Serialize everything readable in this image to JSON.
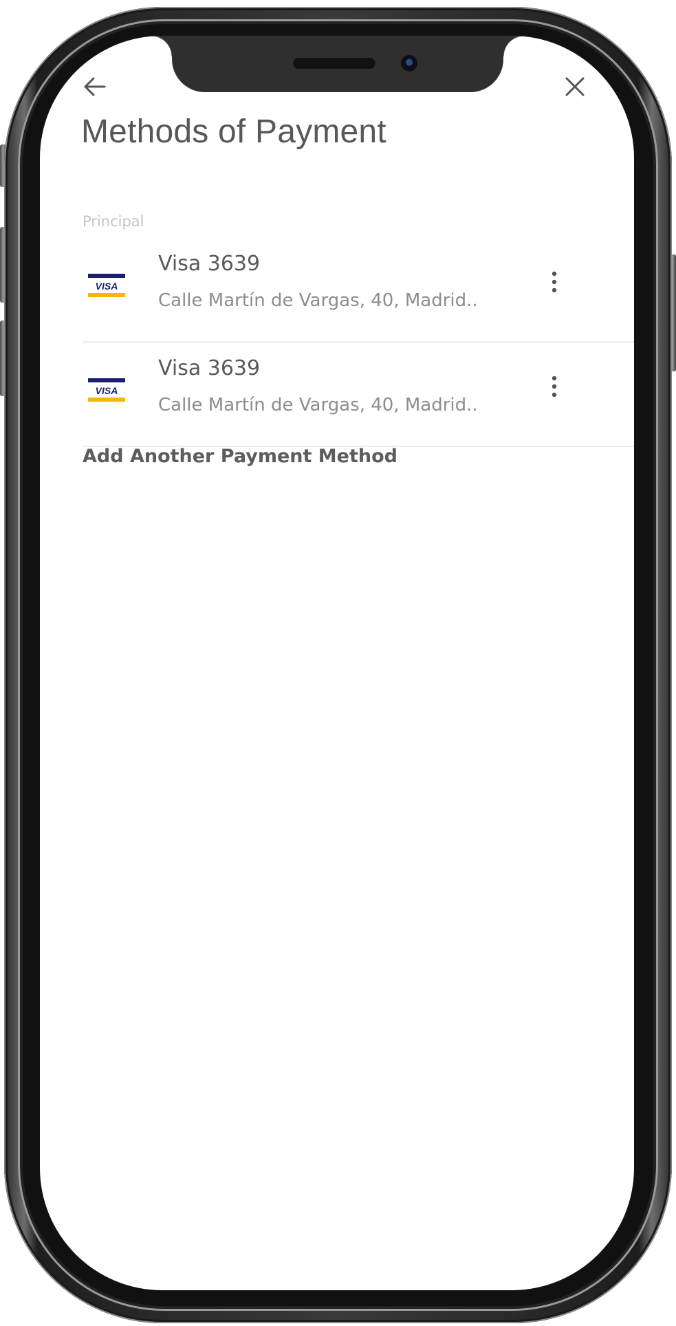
{
  "header": {
    "title": "Methods of Payment",
    "back_icon": "arrow-left-icon",
    "close_icon": "close-icon"
  },
  "section": {
    "label": "Principal"
  },
  "payment_methods": [
    {
      "brand": "VISA",
      "name": "Visa 3639",
      "address": "Calle Martín de Vargas, 40, Madrid..",
      "menu_icon": "more-vertical-icon"
    },
    {
      "brand": "VISA",
      "name": "Visa 3639",
      "address": "Calle Martín de Vargas, 40, Madrid..",
      "menu_icon": "more-vertical-icon"
    }
  ],
  "add_method_label": "Add Another Payment Method",
  "colors": {
    "visa_blue": "#1a1f71",
    "visa_gold": "#f7b600",
    "text_primary": "#575757",
    "text_secondary": "#8d8d8d",
    "divider": "#ececec"
  }
}
